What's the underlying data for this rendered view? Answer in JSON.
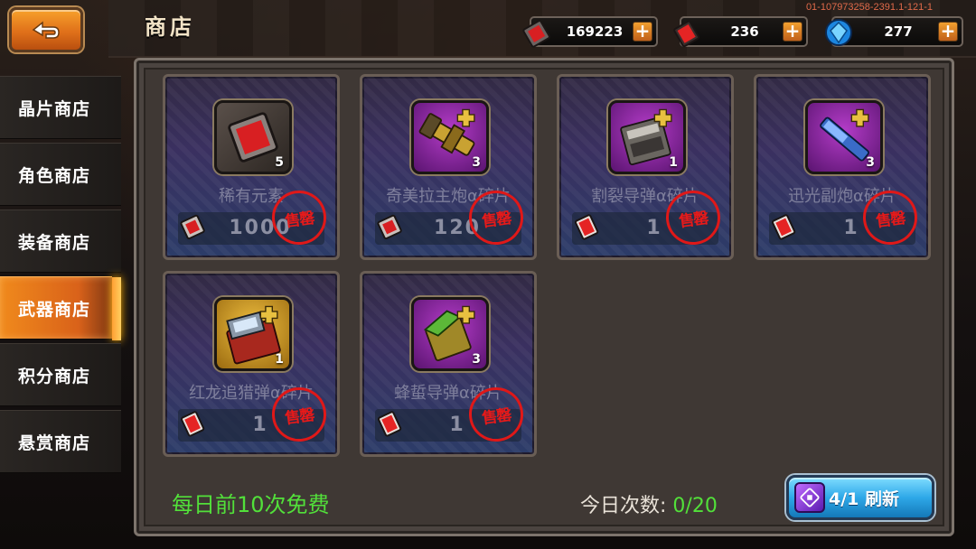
{
  "header": {
    "title": "商店",
    "version": "01-107973258-2391.1-121-1",
    "resources": [
      {
        "icon": "red-cube-icon",
        "value": "169223"
      },
      {
        "icon": "red-gem-icon",
        "value": "236"
      },
      {
        "icon": "blue-crystal-icon",
        "value": "277"
      }
    ]
  },
  "sidebar": {
    "items": [
      {
        "label": "晶片商店",
        "active": false
      },
      {
        "label": "角色商店",
        "active": false
      },
      {
        "label": "装备商店",
        "active": false
      },
      {
        "label": "武器商店",
        "active": true
      },
      {
        "label": "积分商店",
        "active": false
      },
      {
        "label": "悬赏商店",
        "active": false
      }
    ]
  },
  "items": [
    {
      "name": "稀有元素",
      "price": "1000",
      "qty": "5",
      "sold_label": "售罄",
      "thumb": "rare-element-icon"
    },
    {
      "name": "奇美拉主炮α碎片",
      "price": "120",
      "qty": "3",
      "sold_label": "售罄",
      "thumb": "chimera-cannon-icon"
    },
    {
      "name": "割裂导弹α碎片",
      "price": "1",
      "qty": "1",
      "sold_label": "售罄",
      "thumb": "split-missile-icon"
    },
    {
      "name": "迅光副炮α碎片",
      "price": "1",
      "qty": "3",
      "sold_label": "售罄",
      "thumb": "flash-cannon-icon"
    },
    {
      "name": "红龙追猎弹α碎片",
      "price": "1",
      "qty": "1",
      "sold_label": "售罄",
      "thumb": "red-dragon-missile-icon"
    },
    {
      "name": "蜂蜇导弹α碎片",
      "price": "1",
      "qty": "3",
      "sold_label": "售罄",
      "thumb": "bee-sting-missile-icon"
    }
  ],
  "footer": {
    "free_text": "每日前10次免费",
    "count_label": "今日次数: ",
    "count_value": "0/20",
    "refresh_label": "4/1 刷新"
  },
  "colors": {
    "accent_orange": "#e0711a",
    "free_green": "#52e03a",
    "sold_red": "#e01818",
    "refresh_blue": "#2ea8e8"
  }
}
